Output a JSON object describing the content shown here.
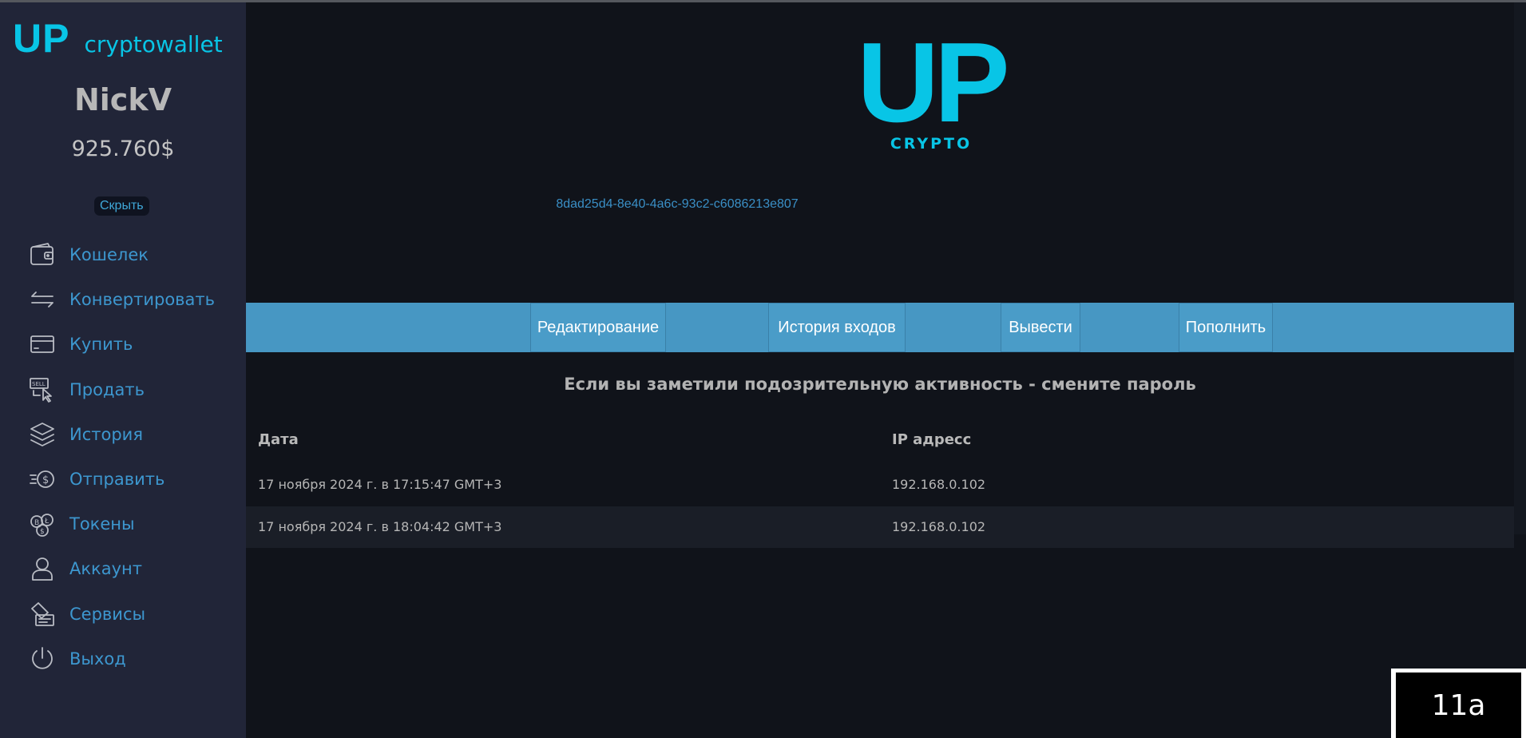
{
  "sidebar": {
    "brand_mark": "UP",
    "brand_name": "cryptowallet",
    "username": "NickV",
    "balance": "925.760$",
    "hide_label": "Скрыть",
    "items": [
      {
        "label": "Кошелек",
        "icon": "wallet-icon"
      },
      {
        "label": "Конвертировать",
        "icon": "convert-arrows-icon"
      },
      {
        "label": "Купить",
        "icon": "card-icon"
      },
      {
        "label": "Продать",
        "icon": "sell-icon"
      },
      {
        "label": "История",
        "icon": "layers-icon"
      },
      {
        "label": "Отправить",
        "icon": "send-dollar-icon"
      },
      {
        "label": "Токены",
        "icon": "coins-icon"
      },
      {
        "label": "Аккаунт",
        "icon": "user-icon"
      },
      {
        "label": "Сервисы",
        "icon": "services-icon"
      },
      {
        "label": "Выход",
        "icon": "power-icon"
      }
    ]
  },
  "main": {
    "logo_mark": "UP",
    "logo_sub": "CRYPTO",
    "wallet_id": "8dad25d4-8e40-4a6c-93c2-c6086213e807",
    "tabs": [
      "Редактирование",
      "История входов",
      "Вывести",
      "Пополнить"
    ],
    "warning": "Если вы заметили подозрительную активность - смените пароль",
    "table": {
      "headers": [
        "Дата",
        "IP адресс"
      ],
      "rows": [
        [
          "17 ноября 2024 г. в 17:15:47 GMT+3",
          "192.168.0.102"
        ],
        [
          "17 ноября 2024 г. в 18:04:42 GMT+3",
          "192.168.0.102"
        ]
      ]
    }
  },
  "badge": "11a",
  "colors": {
    "accent": "#08c5e6",
    "link": "#3d97cf",
    "tab_bar": "#4797c3",
    "sidebar_bg": "#212538",
    "page_bg": "#10131a"
  }
}
